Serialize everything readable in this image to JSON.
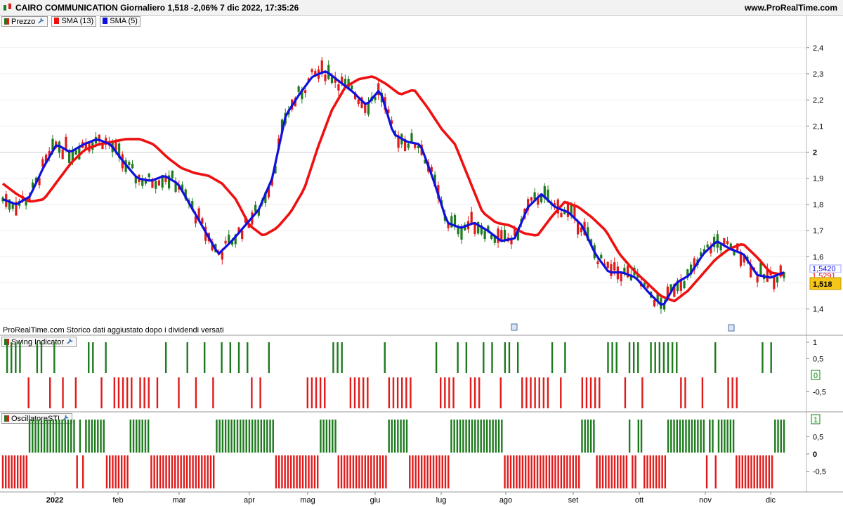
{
  "header": {
    "title": "CAIRO COMMUNICATION Giornaliero 1,518 -2,06% 7 dic 2022, 17:35:26",
    "site": "www.ProRealTime.com"
  },
  "legend": {
    "price_label": "Prezzo",
    "sma13_label": "SMA (13)",
    "sma5_label": "SMA (5)"
  },
  "disclaimer": "ProRealTime.com  Storico dati aggiustato dopo i dividendi versati",
  "panels": {
    "swing_label": "Swing Indicator",
    "sti_label": "OscillatoreSTI"
  },
  "price_badges": {
    "last": "1,518",
    "sma5_value": "1,5420",
    "sma13_value": "1,5291"
  },
  "colors": {
    "up": "#1e7a1e",
    "down": "#e01b1b",
    "sma13": "#ee1111",
    "sma5": "#1010dd",
    "last_badge": "#f5c518"
  },
  "chart_data": [
    {
      "type": "candlestick",
      "title": "CAIRO COMMUNICATION Giornaliero",
      "x_tick_labels": [
        "2022",
        "feb",
        "mar",
        "apr",
        "mag",
        "giu",
        "lug",
        "ago",
        "set",
        "ott",
        "nov",
        "dic"
      ],
      "y_tick_labels": [
        "2,4",
        "2,3",
        "2,2",
        "2,1",
        "2",
        "1,9",
        "1,8",
        "1,7",
        "1,6",
        "1,4"
      ],
      "y_ticks": [
        2.4,
        2.3,
        2.2,
        2.1,
        2.0,
        1.9,
        1.8,
        1.7,
        1.6,
        1.4
      ],
      "ylim": [
        1.34,
        2.48
      ],
      "grid": true,
      "series": [
        {
          "name": "SMA (13)",
          "values": [
            1.88,
            1.84,
            1.81,
            1.82,
            1.89,
            1.96,
            2.01,
            2.03,
            2.04,
            2.05,
            2.05,
            2.03,
            1.98,
            1.94,
            1.92,
            1.91,
            1.88,
            1.82,
            1.72,
            1.68,
            1.71,
            1.77,
            1.86,
            2.02,
            2.16,
            2.25,
            2.28,
            2.29,
            2.26,
            2.22,
            2.24,
            2.17,
            2.09,
            2.03,
            1.9,
            1.77,
            1.73,
            1.72,
            1.69,
            1.68,
            1.75,
            1.81,
            1.79,
            1.75,
            1.7,
            1.61,
            1.55,
            1.5,
            1.45,
            1.43,
            1.47,
            1.53,
            1.59,
            1.63,
            1.65,
            1.6,
            1.54,
            1.53
          ]
        },
        {
          "name": "SMA (5)",
          "values": [
            1.82,
            1.8,
            1.83,
            1.94,
            2.03,
            2.0,
            2.03,
            2.05,
            2.03,
            1.96,
            1.9,
            1.89,
            1.91,
            1.88,
            1.79,
            1.7,
            1.61,
            1.66,
            1.72,
            1.78,
            1.9,
            2.14,
            2.22,
            2.29,
            2.31,
            2.27,
            2.23,
            2.18,
            2.24,
            2.07,
            2.04,
            2.03,
            1.89,
            1.73,
            1.71,
            1.73,
            1.7,
            1.66,
            1.67,
            1.79,
            1.84,
            1.79,
            1.77,
            1.72,
            1.61,
            1.54,
            1.54,
            1.52,
            1.46,
            1.41,
            1.5,
            1.53,
            1.61,
            1.66,
            1.63,
            1.61,
            1.53,
            1.52,
            1.54
          ]
        }
      ]
    },
    {
      "type": "bar",
      "title": "Swing Indicator",
      "y_tick_labels": [
        "1",
        "0,5",
        "0",
        "-0,5"
      ],
      "ylim": [
        -1,
        1
      ],
      "values_encoding": "1 = bar to +1 (green), -1 = bar to -1 (red), 0 = none",
      "values": [
        0,
        1,
        1,
        1,
        1,
        0,
        -1,
        0,
        1,
        1,
        0,
        -1,
        1,
        0,
        -1,
        0,
        0,
        -1,
        0,
        0,
        1,
        1,
        0,
        -1,
        1,
        0,
        -1,
        -1,
        -1,
        -1,
        -1,
        0,
        -1,
        -1,
        -1,
        0,
        -1,
        0,
        1,
        0,
        0,
        -1,
        0,
        1,
        0,
        -1,
        0,
        1,
        0,
        -1,
        0,
        1,
        0,
        1,
        0,
        1,
        0,
        1,
        -1,
        0,
        -1,
        0,
        1,
        0,
        0,
        0,
        0,
        0,
        0,
        0,
        0,
        -1,
        -1,
        -1,
        -1,
        -1,
        0,
        1,
        1,
        1,
        0,
        -1,
        -1,
        -1,
        -1,
        -1,
        0,
        0,
        0,
        1,
        -1,
        -1,
        -1,
        -1,
        -1,
        -1,
        0,
        0,
        0,
        0,
        0,
        1,
        -1,
        -1,
        -1,
        -1,
        1,
        0,
        1,
        -1,
        -1,
        -1,
        1,
        0,
        1,
        0,
        -1,
        1,
        1,
        0,
        1,
        -1,
        -1,
        -1,
        -1,
        -1,
        -1,
        -1,
        1,
        0,
        -1,
        1,
        0,
        0,
        0,
        -1,
        -1,
        -1,
        -1,
        -1,
        0,
        1,
        1,
        1,
        0,
        -1,
        1,
        1,
        1,
        -1,
        0,
        1,
        1,
        1,
        1,
        1,
        1,
        1,
        -1,
        -1,
        0,
        0,
        0,
        -1,
        0,
        0,
        1,
        0,
        0,
        -1,
        -1,
        -1,
        0,
        0,
        0,
        0,
        0,
        1,
        0,
        1,
        0,
        0,
        0
      ]
    },
    {
      "type": "bar",
      "title": "OscillatoreSTI",
      "y_tick_labels": [
        "1",
        "0,5",
        "0",
        "-0,5"
      ],
      "ylim": [
        -1,
        1
      ],
      "values_encoding": "1 = green bar up to +1, -1 = red bar down to -1",
      "runs": [
        [
          -1,
          9
        ],
        [
          1,
          16
        ],
        [
          -1,
          1
        ],
        [
          1,
          1
        ],
        [
          -1,
          1
        ],
        [
          1,
          7
        ],
        [
          -1,
          8
        ],
        [
          1,
          7
        ],
        [
          -1,
          22
        ],
        [
          1,
          20
        ],
        [
          -1,
          15
        ],
        [
          1,
          6
        ],
        [
          -1,
          17
        ],
        [
          1,
          7
        ],
        [
          -1,
          14
        ],
        [
          1,
          18
        ],
        [
          -1,
          26
        ],
        [
          1,
          5
        ],
        [
          -1,
          11
        ],
        [
          1,
          1
        ],
        [
          -1,
          2
        ],
        [
          1,
          2
        ],
        [
          -1,
          8
        ],
        [
          1,
          13
        ],
        [
          -1,
          1
        ],
        [
          1,
          2
        ],
        [
          -1,
          1
        ],
        [
          1,
          6
        ],
        [
          -1,
          13
        ],
        [
          1,
          4
        ]
      ]
    }
  ]
}
